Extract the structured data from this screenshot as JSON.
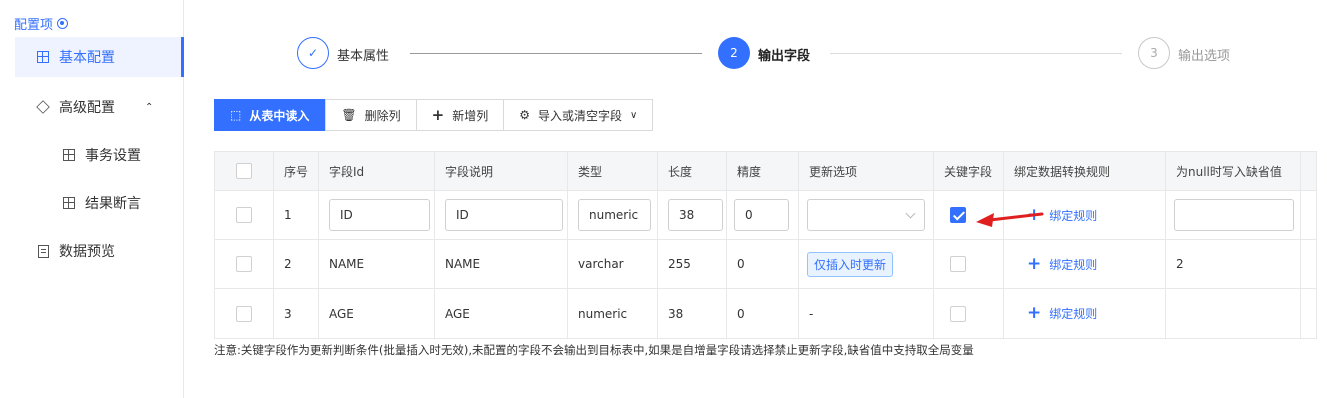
{
  "sidebar": {
    "title": "配置项",
    "items": [
      {
        "label": "基本配置"
      },
      {
        "label": "高级配置"
      },
      {
        "label": "事务设置"
      },
      {
        "label": "结果断言"
      },
      {
        "label": "数据预览"
      }
    ]
  },
  "steps": [
    {
      "label": "基本属性",
      "marker": "✓",
      "state": "done"
    },
    {
      "label": "输出字段",
      "marker": "2",
      "state": "active"
    },
    {
      "label": "输出选项",
      "marker": "3",
      "state": "todo"
    }
  ],
  "toolbar": {
    "read_from_table": "从表中读入",
    "delete_col": "删除列",
    "add_col": "新增列",
    "import_clear": "导入或清空字段"
  },
  "table": {
    "headers": [
      "序号",
      "字段Id",
      "字段说明",
      "类型",
      "长度",
      "精度",
      "更新选项",
      "关键字段",
      "绑定数据转换规则",
      "为null时写入缺省值"
    ],
    "rows": [
      {
        "index": "1",
        "field_id": "ID",
        "field_desc": "ID",
        "type": "numeric",
        "length": "38",
        "precision": "0",
        "update": "",
        "key": true,
        "bind": "绑定规则",
        "default": ""
      },
      {
        "index": "2",
        "field_id": "NAME",
        "field_desc": "NAME",
        "type": "varchar",
        "length": "255",
        "precision": "0",
        "update": "仅插入时更新",
        "key": false,
        "bind": "绑定规则",
        "default": "2"
      },
      {
        "index": "3",
        "field_id": "AGE",
        "field_desc": "AGE",
        "type": "numeric",
        "length": "38",
        "precision": "0",
        "update": "-",
        "key": false,
        "bind": "绑定规则",
        "default": ""
      }
    ]
  },
  "note": "注意:关键字段作为更新判断条件(批量插入时无效),未配置的字段不会输出到目标表中,如果是自增量字段请选择禁止更新字段,缺省值中支持取全局变量",
  "colors": {
    "accent": "#3370ff",
    "arrow": "#e02020"
  }
}
